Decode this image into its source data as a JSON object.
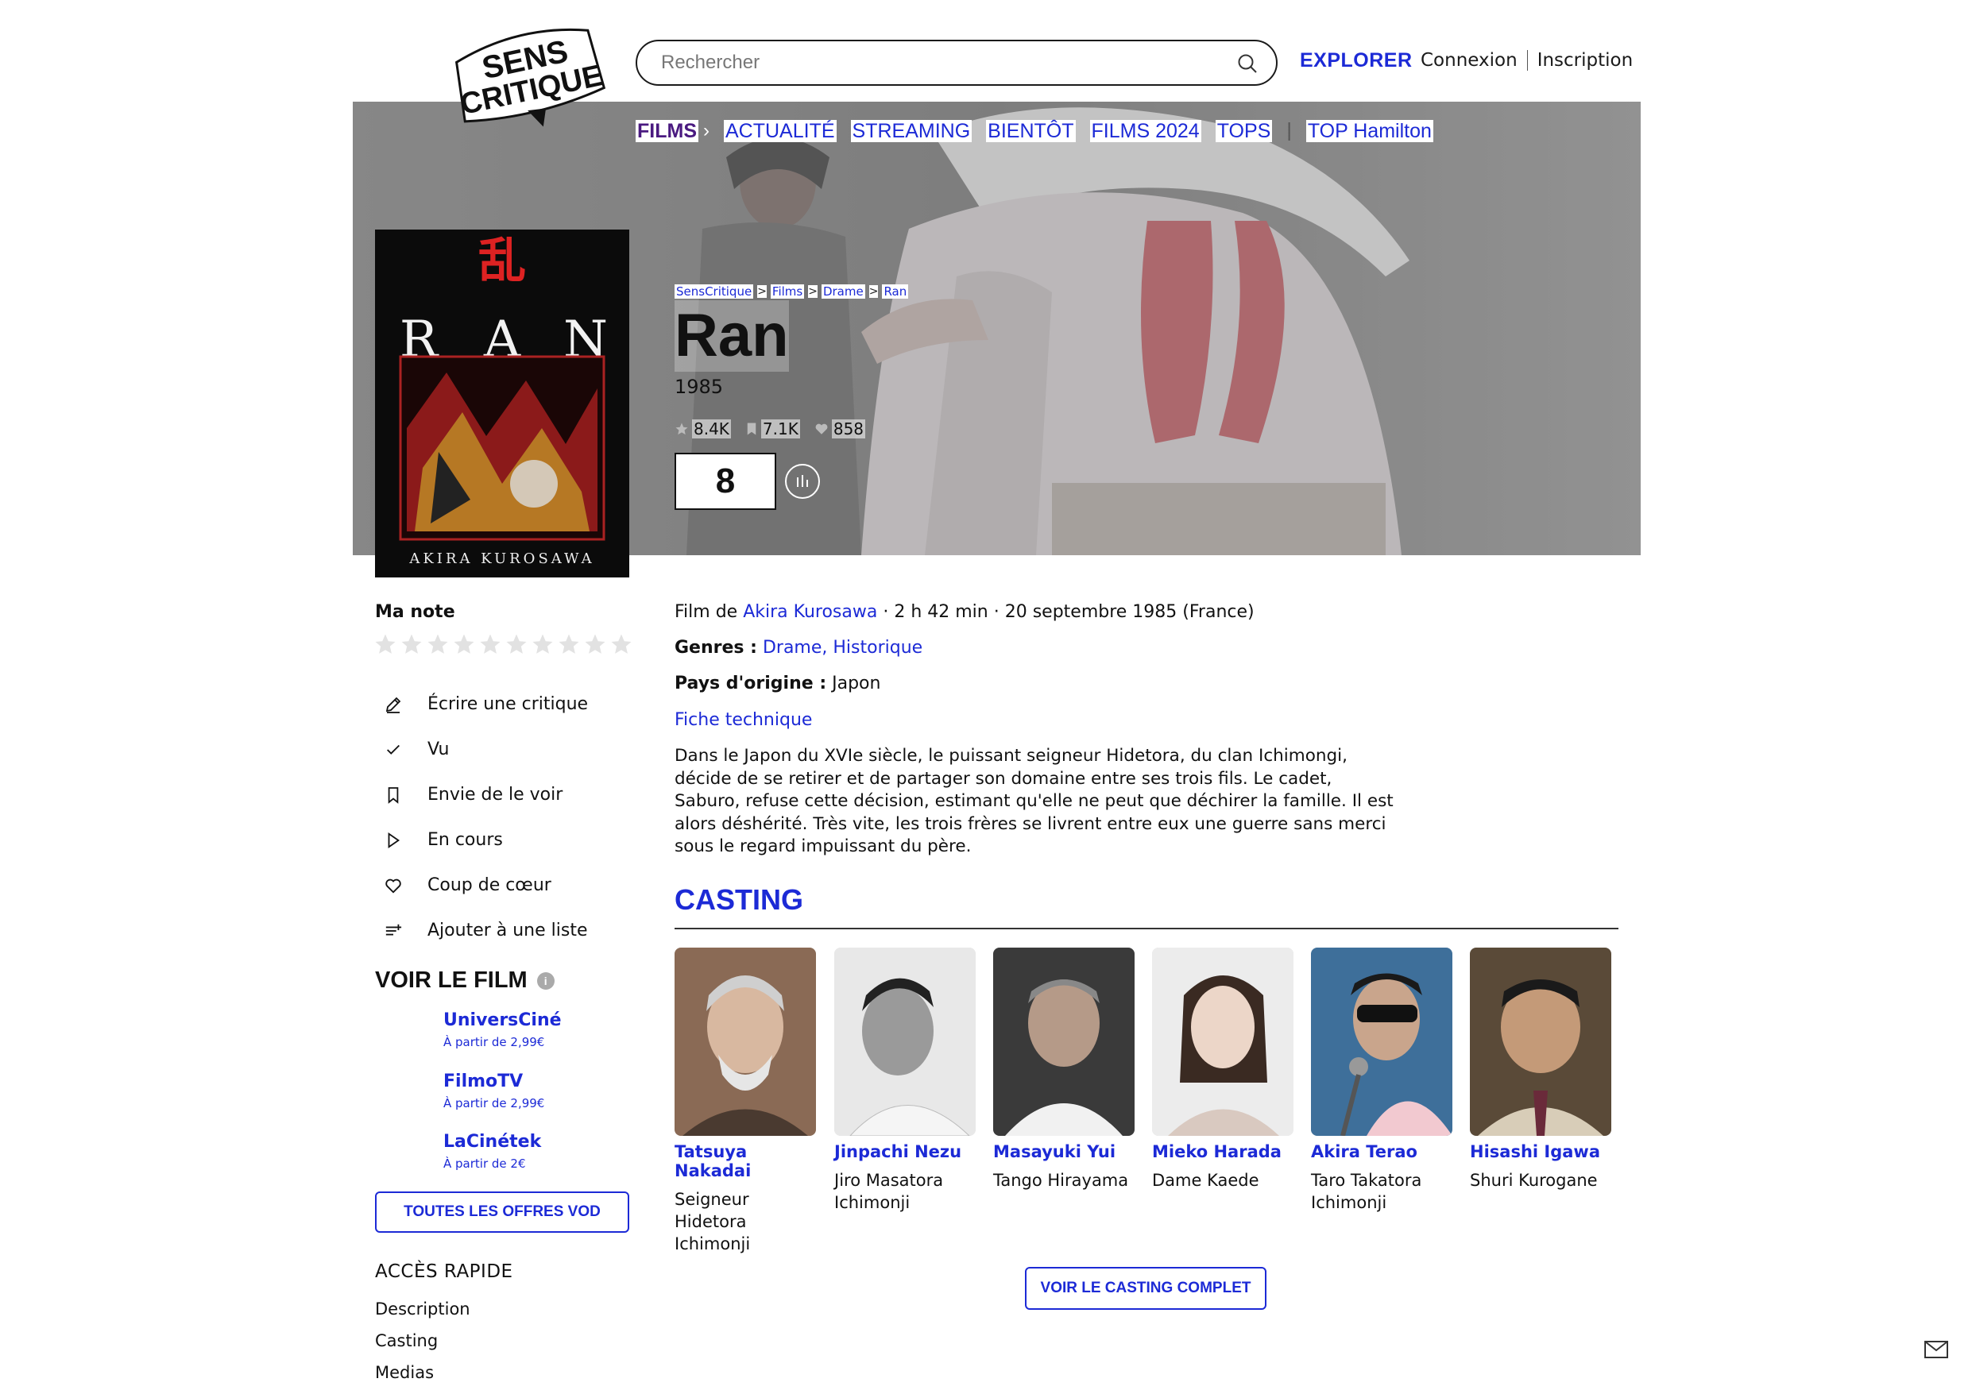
{
  "header": {
    "search_placeholder": "Rechercher",
    "explore": "EXPLORER",
    "login": "Connexion",
    "signup": "Inscription"
  },
  "subnav": {
    "active": "FILMS",
    "items": [
      "ACTUALITÉ",
      "STREAMING",
      "BIENTÔT",
      "FILMS 2024",
      "TOPS"
    ],
    "extra": "TOP Hamilton"
  },
  "breadcrumb": [
    "SensCritique",
    "Films",
    "Drame",
    "Ran"
  ],
  "film": {
    "title": "Ran",
    "year": "1985",
    "stats": {
      "ratings": "8.4K",
      "wishlist": "7.1K",
      "favorites": "858"
    },
    "score": "8",
    "director_prefix": "Film de ",
    "director": "Akira Kurosawa",
    "details": " · 2 h 42 min · 20 septembre 1985 (France)",
    "genres_label": "Genres :",
    "genres": "Drame, Historique",
    "country_label": "Pays d'origine :",
    "country": " Japon",
    "tech_sheet": "Fiche technique",
    "synopsis": "Dans le Japon du XVIe siècle, le puissant seigneur Hidetora, du clan Ichimongi, décide de se retirer et de partager son domaine entre ses trois fils. Le cadet, Saburo, refuse cette décision, estimant qu'elle ne peut que déchirer la famille. Il est alors déshérité. Très vite, les trois frères se livrent entre eux une guerre sans merci sous le regard impuissant du père."
  },
  "poster": {
    "kanji": "乱",
    "letters": [
      "R",
      "A",
      "N"
    ],
    "credit": "AKIRA  KUROSAWA"
  },
  "sidebar": {
    "my_rating": "Ma note",
    "actions": [
      "Écrire une critique",
      "Vu",
      "Envie de le voir",
      "En cours",
      "Coup de cœur",
      "Ajouter à une liste"
    ],
    "watch_title": "VOIR LE FILM",
    "vod": [
      {
        "name": "UniversCiné",
        "price": "À partir de 2,99€"
      },
      {
        "name": "FilmoTV",
        "price": "À partir de 2,99€"
      },
      {
        "name": "LaCinétek",
        "price": "À partir de 2€"
      }
    ],
    "vod_button": "TOUTES LES OFFRES VOD",
    "quick_title": "ACCÈS RAPIDE",
    "quick_links": [
      "Description",
      "Casting",
      "Medias"
    ]
  },
  "casting": {
    "title": "CASTING",
    "actors": [
      {
        "name": "Tatsuya Nakadai",
        "role": "Seigneur Hidetora Ichimonji"
      },
      {
        "name": "Jinpachi Nezu",
        "role": "Jiro Masatora Ichimonji"
      },
      {
        "name": "Masayuki Yui",
        "role": "Tango Hirayama"
      },
      {
        "name": "Mieko Harada",
        "role": "Dame Kaede"
      },
      {
        "name": "Akira Terao",
        "role": "Taro Takatora Ichimonji"
      },
      {
        "name": "Hisashi Igawa",
        "role": "Shuri Kurogane"
      }
    ],
    "button": "VOIR LE CASTING COMPLET"
  },
  "colors": {
    "accent": "#1c2ad6",
    "active_nav": "#4a1a80"
  }
}
